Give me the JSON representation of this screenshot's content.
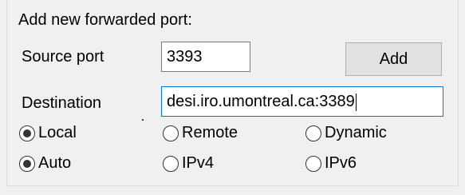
{
  "section_title": "Add new forwarded port:",
  "source_port": {
    "label": "Source port",
    "value": "3393"
  },
  "add_button_label": "Add",
  "destination": {
    "label": "Destination",
    "value": "desi.iro.umontreal.ca:3389"
  },
  "direction": {
    "options": [
      {
        "label": "Local",
        "selected": true
      },
      {
        "label": "Remote",
        "selected": false
      },
      {
        "label": "Dynamic",
        "selected": false
      }
    ]
  },
  "ip_version": {
    "options": [
      {
        "label": "Auto",
        "selected": true
      },
      {
        "label": "IPv4",
        "selected": false
      },
      {
        "label": "IPv6",
        "selected": false
      }
    ]
  }
}
